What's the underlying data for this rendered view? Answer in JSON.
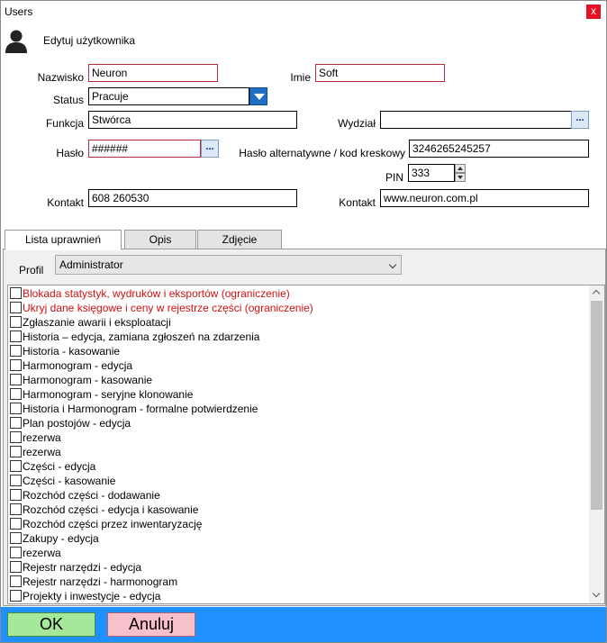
{
  "window": {
    "title": "Users",
    "close_symbol": "x"
  },
  "header": {
    "title": "Edytuj użytkownika",
    "icon": "user-avatar-icon"
  },
  "form": {
    "nazwisko": {
      "label": "Nazwisko",
      "value": "Neuron"
    },
    "imie": {
      "label": "Imie",
      "value": "Soft"
    },
    "status": {
      "label": "Status",
      "value": "Pracuje"
    },
    "funkcja": {
      "label": "Funkcja",
      "value": "Stwórca"
    },
    "wydzial": {
      "label": "Wydział",
      "value": "",
      "button": "..."
    },
    "haslo": {
      "label": "Hasło",
      "value": "######",
      "button": "..."
    },
    "haslo_alt": {
      "label": "Hasło alternatywne / kod kreskowy",
      "value": "3246265245257"
    },
    "pin": {
      "label": "PIN",
      "value": "333"
    },
    "kontakt1": {
      "label": "Kontakt",
      "value": "608 260530"
    },
    "kontakt2": {
      "label": "Kontakt",
      "value": "www.neuron.com.pl"
    }
  },
  "tabs": [
    {
      "label": "Lista uprawnień",
      "active": true
    },
    {
      "label": "Opis",
      "active": false
    },
    {
      "label": "Zdjęcie",
      "active": false
    }
  ],
  "permissions": {
    "profile_label": "Profil",
    "profile_value": "Administrator",
    "items": [
      {
        "label": "Blokada statystyk, wydruków i eksportów (ograniczenie)",
        "warn": true,
        "checked": false
      },
      {
        "label": "Ukryj dane księgowe i ceny w rejestrze części (ograniczenie)",
        "warn": true,
        "checked": false
      },
      {
        "label": "Zgłaszanie awarii i eksploatacji",
        "warn": false,
        "checked": false
      },
      {
        "label": "Historia – edycja, zamiana zgłoszeń  na zdarzenia",
        "warn": false,
        "checked": false
      },
      {
        "label": "Historia - kasowanie",
        "warn": false,
        "checked": false
      },
      {
        "label": "Harmonogram - edycja",
        "warn": false,
        "checked": false
      },
      {
        "label": "Harmonogram - kasowanie",
        "warn": false,
        "checked": false
      },
      {
        "label": "Harmonogram - seryjne klonowanie",
        "warn": false,
        "checked": false
      },
      {
        "label": "Historia i Harmonogram - formalne potwierdzenie",
        "warn": false,
        "checked": false
      },
      {
        "label": "Plan postojów - edycja",
        "warn": false,
        "checked": false
      },
      {
        "label": "rezerwa",
        "warn": false,
        "checked": false
      },
      {
        "label": "rezerwa",
        "warn": false,
        "checked": false
      },
      {
        "label": "Części - edycja",
        "warn": false,
        "checked": false
      },
      {
        "label": "Części - kasowanie",
        "warn": false,
        "checked": false
      },
      {
        "label": "Rozchód części - dodawanie",
        "warn": false,
        "checked": false
      },
      {
        "label": "Rozchód części - edycja i kasowanie",
        "warn": false,
        "checked": false
      },
      {
        "label": "Rozchód części przez inwentaryzację",
        "warn": false,
        "checked": false
      },
      {
        "label": "Zakupy - edycja",
        "warn": false,
        "checked": false
      },
      {
        "label": "rezerwa",
        "warn": false,
        "checked": false
      },
      {
        "label": "Rejestr narzędzi - edycja",
        "warn": false,
        "checked": false
      },
      {
        "label": "Rejestr narzędzi - harmonogram",
        "warn": false,
        "checked": false
      },
      {
        "label": "Projekty i inwestycje - edycja",
        "warn": false,
        "checked": false
      }
    ]
  },
  "footer": {
    "ok_label": "OK",
    "cancel_label": "Anuluj"
  },
  "colors": {
    "accent_bar": "#1e90ff",
    "ok": "#a6e89a",
    "cancel": "#f8c0c8",
    "warn_text": "#d01010"
  }
}
